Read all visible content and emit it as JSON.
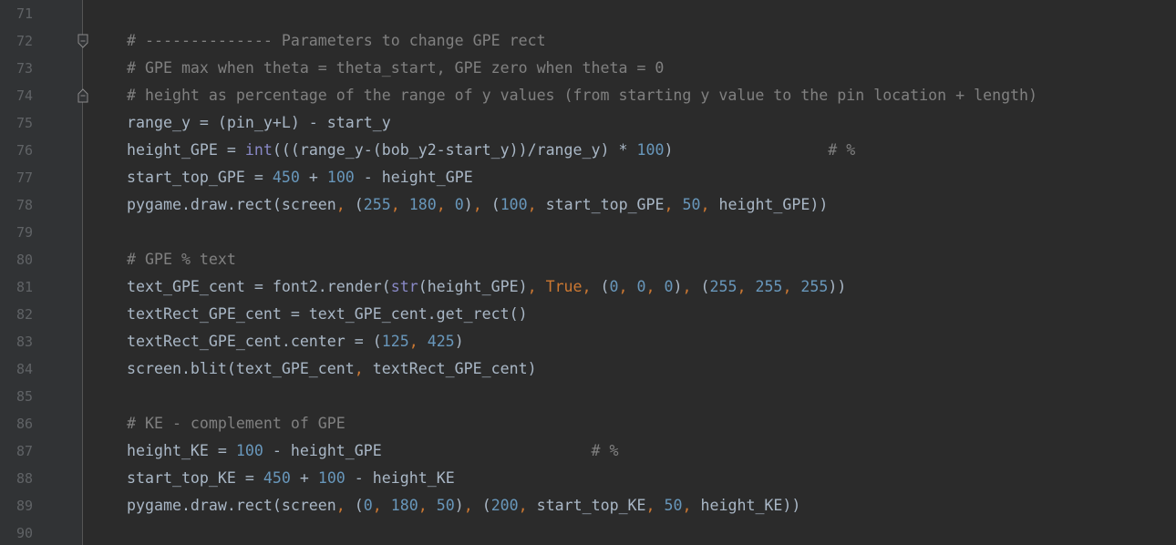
{
  "colors": {
    "background": "#2b2b2b",
    "gutter": "#313335",
    "line_number": "#606366",
    "plain": "#a9b7c6",
    "comment": "#808080",
    "number": "#6897bb",
    "keyword": "#cc7832",
    "builtin": "#8888c6"
  },
  "lines": [
    {
      "number": "71",
      "tokens": []
    },
    {
      "number": "72",
      "fold": "fold-start-icon",
      "tokens": [
        {
          "t": "cm",
          "v": "# -------------- Parameters to change GPE rect"
        }
      ]
    },
    {
      "number": "73",
      "tokens": [
        {
          "t": "cm",
          "v": "# GPE max when theta = theta_start, GPE zero when theta = 0"
        }
      ]
    },
    {
      "number": "74",
      "fold": "fold-end-icon",
      "tokens": [
        {
          "t": "cm",
          "v": "# height as percentage of the range of y values (from starting y value to the pin location + length)"
        }
      ]
    },
    {
      "number": "75",
      "tokens": [
        {
          "t": "pl",
          "v": "range_y = (pin_y+L) - start_y"
        }
      ]
    },
    {
      "number": "76",
      "tokens": [
        {
          "t": "pl",
          "v": "height_GPE = "
        },
        {
          "t": "bi",
          "v": "int"
        },
        {
          "t": "pl",
          "v": "(((range_y-(bob_y2-start_y))/range_y) * "
        },
        {
          "t": "num",
          "v": "100"
        },
        {
          "t": "pl",
          "v": ")                 "
        },
        {
          "t": "cm",
          "v": "# %"
        }
      ]
    },
    {
      "number": "77",
      "tokens": [
        {
          "t": "pl",
          "v": "start_top_GPE = "
        },
        {
          "t": "num",
          "v": "450"
        },
        {
          "t": "pl",
          "v": " + "
        },
        {
          "t": "num",
          "v": "100"
        },
        {
          "t": "pl",
          "v": " - height_GPE"
        }
      ]
    },
    {
      "number": "78",
      "tokens": [
        {
          "t": "pl",
          "v": "pygame.draw.rect(screen"
        },
        {
          "t": "kw",
          "v": ", "
        },
        {
          "t": "pl",
          "v": "("
        },
        {
          "t": "num",
          "v": "255"
        },
        {
          "t": "kw",
          "v": ", "
        },
        {
          "t": "num",
          "v": "180"
        },
        {
          "t": "kw",
          "v": ", "
        },
        {
          "t": "num",
          "v": "0"
        },
        {
          "t": "pl",
          "v": ")"
        },
        {
          "t": "kw",
          "v": ", "
        },
        {
          "t": "pl",
          "v": "("
        },
        {
          "t": "num",
          "v": "100"
        },
        {
          "t": "kw",
          "v": ", "
        },
        {
          "t": "pl",
          "v": "start_top_GPE"
        },
        {
          "t": "kw",
          "v": ", "
        },
        {
          "t": "num",
          "v": "50"
        },
        {
          "t": "kw",
          "v": ", "
        },
        {
          "t": "pl",
          "v": "height_GPE))"
        }
      ]
    },
    {
      "number": "79",
      "tokens": []
    },
    {
      "number": "80",
      "tokens": [
        {
          "t": "cm",
          "v": "# GPE % text"
        }
      ]
    },
    {
      "number": "81",
      "tokens": [
        {
          "t": "pl",
          "v": "text_GPE_cent = font2.render("
        },
        {
          "t": "bi",
          "v": "str"
        },
        {
          "t": "pl",
          "v": "(height_GPE)"
        },
        {
          "t": "kw",
          "v": ", True, "
        },
        {
          "t": "pl",
          "v": "("
        },
        {
          "t": "num",
          "v": "0"
        },
        {
          "t": "kw",
          "v": ", "
        },
        {
          "t": "num",
          "v": "0"
        },
        {
          "t": "kw",
          "v": ", "
        },
        {
          "t": "num",
          "v": "0"
        },
        {
          "t": "pl",
          "v": ")"
        },
        {
          "t": "kw",
          "v": ", "
        },
        {
          "t": "pl",
          "v": "("
        },
        {
          "t": "num",
          "v": "255"
        },
        {
          "t": "kw",
          "v": ", "
        },
        {
          "t": "num",
          "v": "255"
        },
        {
          "t": "kw",
          "v": ", "
        },
        {
          "t": "num",
          "v": "255"
        },
        {
          "t": "pl",
          "v": "))"
        }
      ]
    },
    {
      "number": "82",
      "tokens": [
        {
          "t": "pl",
          "v": "textRect_GPE_cent = text_GPE_cent.get_rect()"
        }
      ]
    },
    {
      "number": "83",
      "tokens": [
        {
          "t": "pl",
          "v": "textRect_GPE_cent.center = ("
        },
        {
          "t": "num",
          "v": "125"
        },
        {
          "t": "kw",
          "v": ", "
        },
        {
          "t": "num",
          "v": "425"
        },
        {
          "t": "pl",
          "v": ")"
        }
      ]
    },
    {
      "number": "84",
      "tokens": [
        {
          "t": "pl",
          "v": "screen.blit(text_GPE_cent"
        },
        {
          "t": "kw",
          "v": ", "
        },
        {
          "t": "pl",
          "v": "textRect_GPE_cent)"
        }
      ]
    },
    {
      "number": "85",
      "tokens": []
    },
    {
      "number": "86",
      "tokens": [
        {
          "t": "cm",
          "v": "# KE - complement of GPE"
        }
      ]
    },
    {
      "number": "87",
      "tokens": [
        {
          "t": "pl",
          "v": "height_KE = "
        },
        {
          "t": "num",
          "v": "100"
        },
        {
          "t": "pl",
          "v": " - height_GPE                       "
        },
        {
          "t": "cm",
          "v": "# %"
        }
      ]
    },
    {
      "number": "88",
      "tokens": [
        {
          "t": "pl",
          "v": "start_top_KE = "
        },
        {
          "t": "num",
          "v": "450"
        },
        {
          "t": "pl",
          "v": " + "
        },
        {
          "t": "num",
          "v": "100"
        },
        {
          "t": "pl",
          "v": " - height_KE"
        }
      ]
    },
    {
      "number": "89",
      "tokens": [
        {
          "t": "pl",
          "v": "pygame.draw.rect(screen"
        },
        {
          "t": "kw",
          "v": ", "
        },
        {
          "t": "pl",
          "v": "("
        },
        {
          "t": "num",
          "v": "0"
        },
        {
          "t": "kw",
          "v": ", "
        },
        {
          "t": "num",
          "v": "180"
        },
        {
          "t": "kw",
          "v": ", "
        },
        {
          "t": "num",
          "v": "50"
        },
        {
          "t": "pl",
          "v": ")"
        },
        {
          "t": "kw",
          "v": ", "
        },
        {
          "t": "pl",
          "v": "("
        },
        {
          "t": "num",
          "v": "200"
        },
        {
          "t": "kw",
          "v": ", "
        },
        {
          "t": "pl",
          "v": "start_top_KE"
        },
        {
          "t": "kw",
          "v": ", "
        },
        {
          "t": "num",
          "v": "50"
        },
        {
          "t": "kw",
          "v": ", "
        },
        {
          "t": "pl",
          "v": "height_KE))"
        }
      ]
    },
    {
      "number": "90",
      "tokens": []
    }
  ]
}
